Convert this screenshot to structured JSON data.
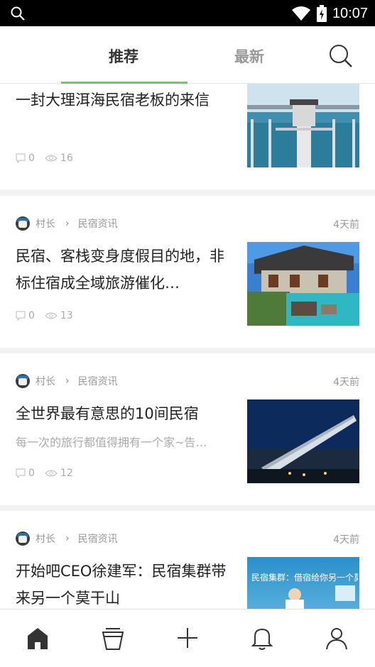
{
  "status_bar": {
    "time": "10:07"
  },
  "header": {
    "tabs": [
      {
        "label": "推荐",
        "active": true
      },
      {
        "label": "最新",
        "active": false
      }
    ]
  },
  "articles": [
    {
      "title": "一封大理洱海民宿老板的来信",
      "comments": "0",
      "views": "16"
    },
    {
      "author": "村长",
      "category": "民宿资讯",
      "date": "4天前",
      "title": "民宿、客栈变身度假目的地，非标住宿成全域旅游催化…",
      "comments": "0",
      "views": "13"
    },
    {
      "author": "村长",
      "category": "民宿资讯",
      "date": "4天前",
      "title": "全世界最有意思的10间民宿",
      "subtitle": "每一次的旅行都值得拥有一个家~告…",
      "comments": "0",
      "views": "12"
    },
    {
      "author": "村长",
      "category": "民宿资讯",
      "date": "4天前",
      "title": "开始吧CEO徐建军：民宿集群带来另一个莫干山",
      "thumb_text": "民宿集群：借宿给你另一个莫干山"
    }
  ],
  "colors": {
    "accent": "#6bc96b",
    "text": "#222222",
    "muted": "#999999"
  },
  "bottom_nav": [
    "home-icon",
    "cup-icon",
    "plus-icon",
    "bell-icon",
    "user-icon"
  ]
}
